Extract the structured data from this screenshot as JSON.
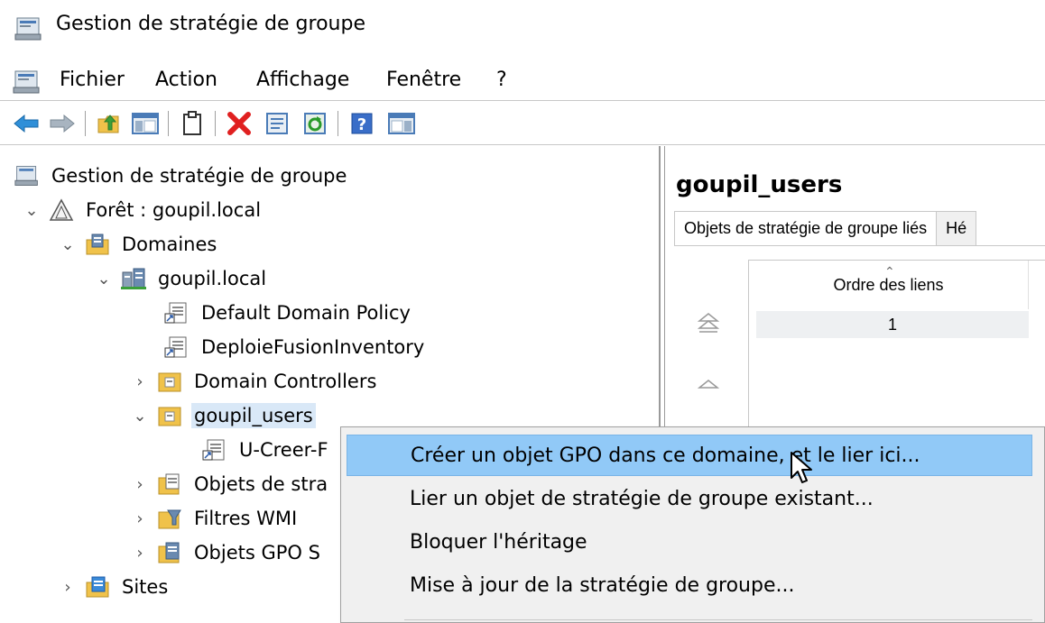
{
  "window": {
    "title": "Gestion de stratégie de groupe",
    "icon": "gpmc-app-icon"
  },
  "menubar": {
    "items": [
      "Fichier",
      "Action",
      "Affichage",
      "Fenêtre",
      "?"
    ]
  },
  "toolbar": {
    "buttons": [
      "back-icon",
      "forward-icon",
      "up-folder-icon",
      "show-hide-console-tree-icon",
      "clipboard-icon",
      "delete-icon",
      "properties-icon",
      "refresh-icon",
      "help-icon",
      "action-pane-icon"
    ]
  },
  "tree": {
    "root": "Gestion de stratégie de groupe",
    "forest": "Forêt : goupil.local",
    "domains": "Domaines",
    "domain": "goupil.local",
    "default_policy": "Default Domain Policy",
    "deploie": "DeploieFusionInventory",
    "domain_controllers": "Domain Controllers",
    "goupil_users": "goupil_users",
    "u_creer": "U-Creer-F",
    "objets_strat": "Objets de stra",
    "filtres_wmi": "Filtres WMI",
    "objets_gpo": "Objets GPO S",
    "sites": "Sites"
  },
  "right_pane": {
    "title": "goupil_users",
    "tabs": [
      "Objets de stratégie de groupe liés",
      "Hé"
    ],
    "column_header": "Ordre des liens",
    "rows": [
      {
        "order": "1"
      }
    ]
  },
  "context_menu": {
    "items": [
      "Créer un objet GPO dans ce domaine, et le lier ici...",
      "Lier un objet de stratégie de groupe existant...",
      "Bloquer l'héritage",
      "Mise à jour de la stratégie de groupe..."
    ],
    "highlighted_index": 0
  },
  "colors": {
    "highlight": "#91c9f7",
    "menu_bg": "#f0f0f0"
  }
}
